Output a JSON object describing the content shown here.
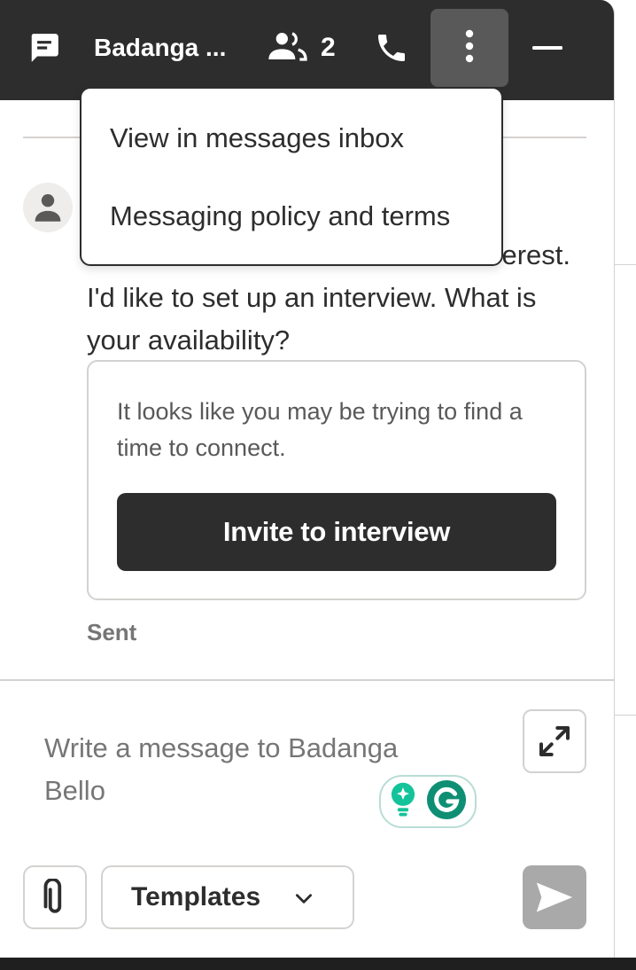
{
  "header": {
    "chat_icon": "chat-bubble-icon",
    "title": "Badanga ...",
    "participants_icon": "people-icon",
    "participants_count": "2",
    "call_icon": "phone-icon",
    "more_icon": "more-vertical-icon",
    "minimize_icon": "minimize-icon"
  },
  "menu": {
    "items": [
      {
        "label": "View in messages inbox"
      },
      {
        "label": "Messaging policy and terms"
      }
    ]
  },
  "conversation": {
    "avatar_icon": "person-icon",
    "message_partial_line": "erest.",
    "message_rest": "I'd like to set up an interview. What is your availability?",
    "suggestion": {
      "text": "It looks like you may be trying to find a time to connect.",
      "button_label": "Invite to interview"
    },
    "status": "Sent"
  },
  "composer": {
    "placeholder": "Write a message to Badanga Bello",
    "expand_icon": "expand-icon",
    "extension_icons": [
      "lightbulb-icon",
      "grammarly-icon"
    ],
    "attach_icon": "paperclip-icon",
    "templates_label": "Templates",
    "templates_icon": "chevron-down-icon",
    "send_icon": "send-icon"
  },
  "colors": {
    "header_bg": "#2d2d2d",
    "more_active_bg": "#595959",
    "primary_button": "#2d2d2d",
    "send_disabled": "#a9a9a9",
    "grammarly_green": "#15c39a"
  }
}
